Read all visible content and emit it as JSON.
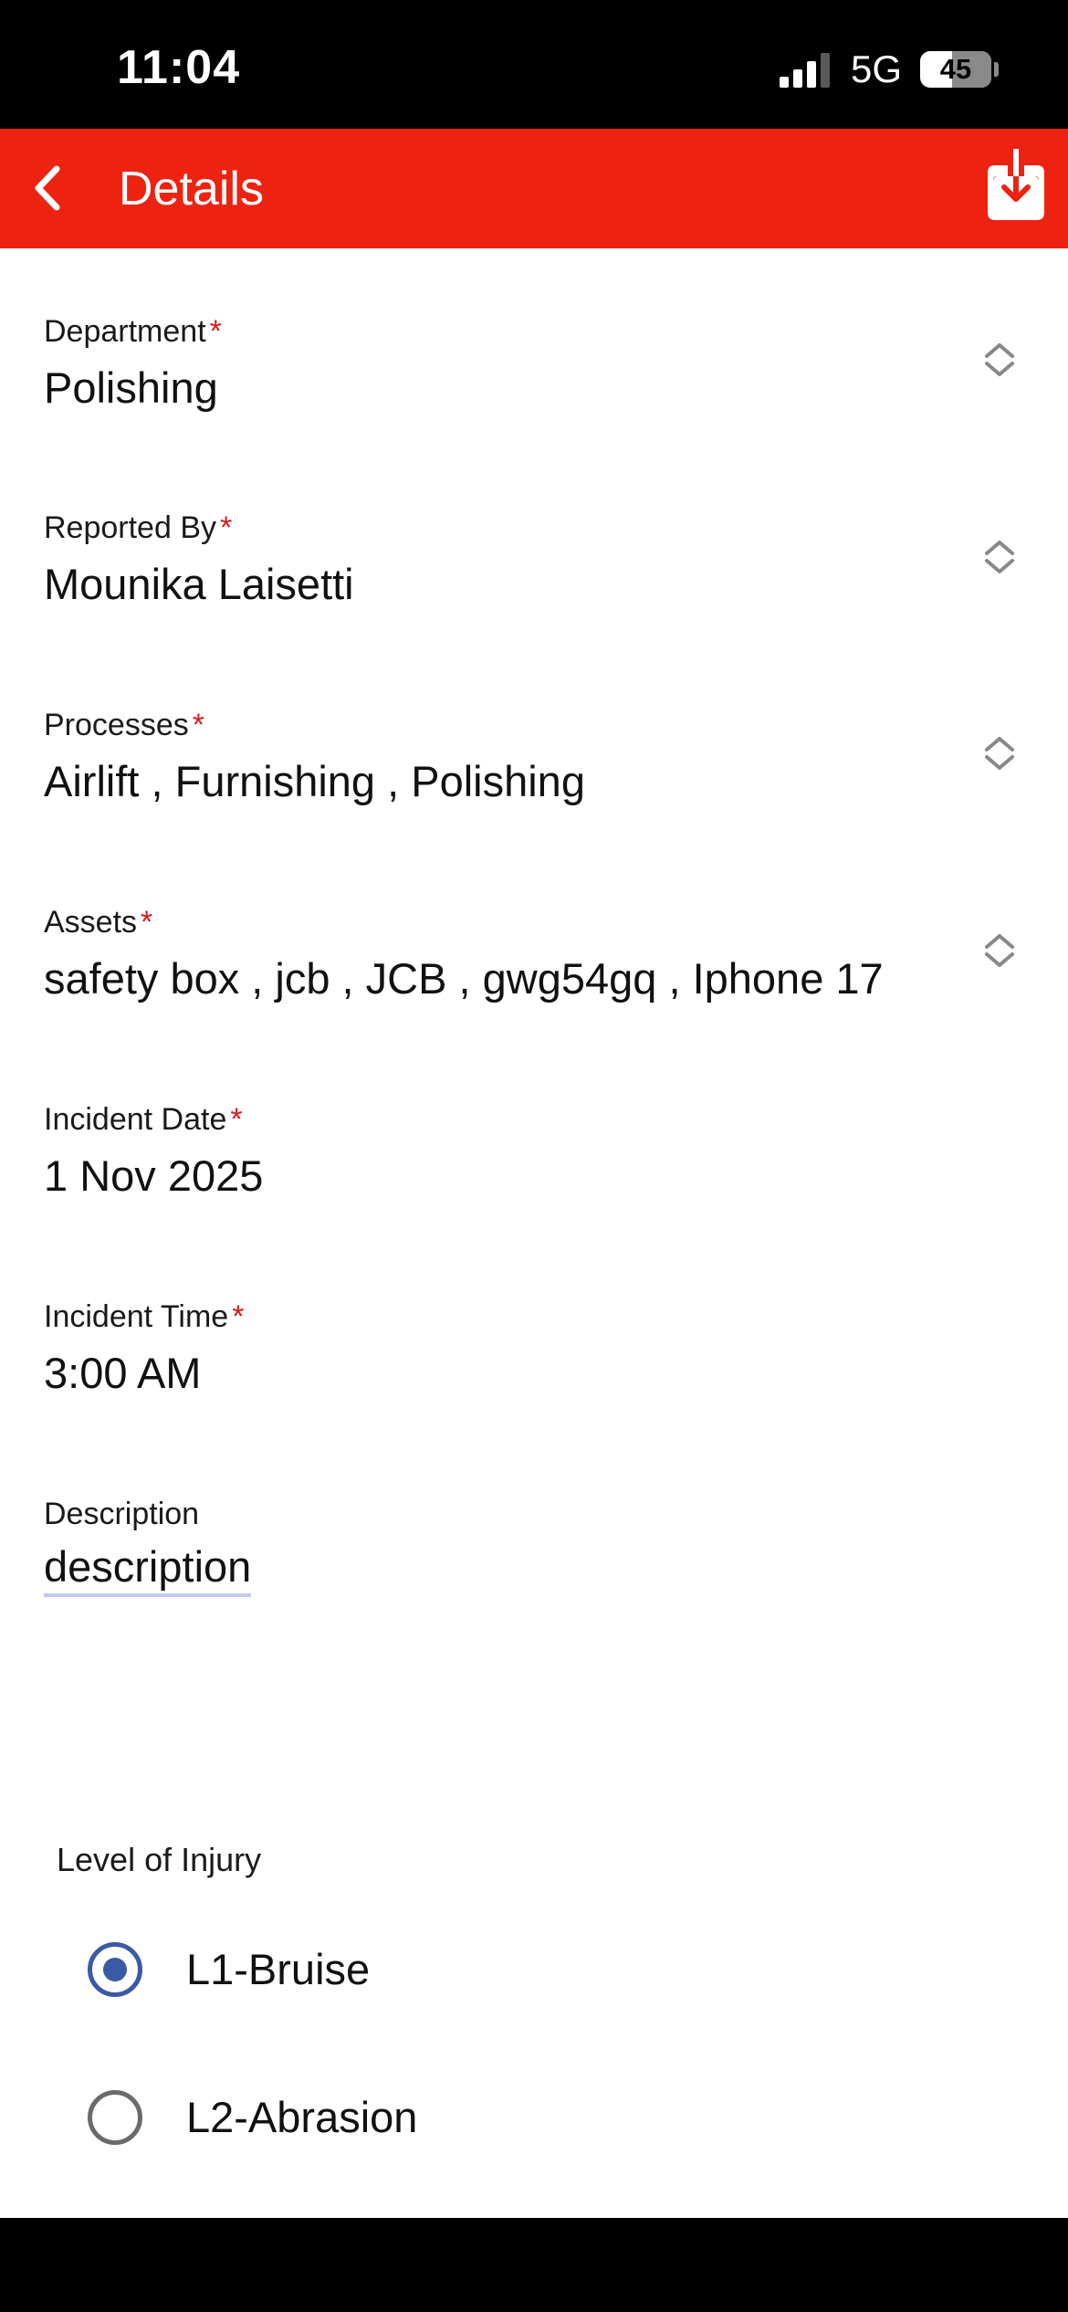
{
  "status_bar": {
    "time": "11:04",
    "network": "5G",
    "battery": "45",
    "battery_level": 0.45
  },
  "app_bar": {
    "title": "Details",
    "background": "#ee2211",
    "back_icon": "chevron-left-icon",
    "download_icon": "download-icon"
  },
  "form": {
    "department": {
      "label": "Department",
      "required_mark": "*",
      "value": "Polishing"
    },
    "reported_by": {
      "label": "Reported By",
      "required_mark": "*",
      "value": "Mounika Laisetti"
    },
    "processes": {
      "label": "Processes",
      "required_mark": "*",
      "value": "Airlift , Furnishing , Polishing"
    },
    "assets": {
      "label": "Assets",
      "required_mark": "*",
      "value": "safety box , jcb , JCB , gwg54gq , Iphone 17"
    },
    "incident_date": {
      "label": "Incident Date",
      "required_mark": "*",
      "value": "1 Nov 2025"
    },
    "incident_time": {
      "label": "Incident Time",
      "required_mark": "*",
      "value": "3:00 AM"
    },
    "description": {
      "label": "Description",
      "value": "description"
    }
  },
  "injury": {
    "heading": "Level of Injury",
    "options": [
      {
        "label": "L1-Bruise",
        "selected": true
      },
      {
        "label": "L2-Abrasion",
        "selected": false
      }
    ]
  },
  "colors": {
    "accent": "#ee2211",
    "required": "#d81b1b",
    "radio_selected": "#3b5aa6"
  }
}
